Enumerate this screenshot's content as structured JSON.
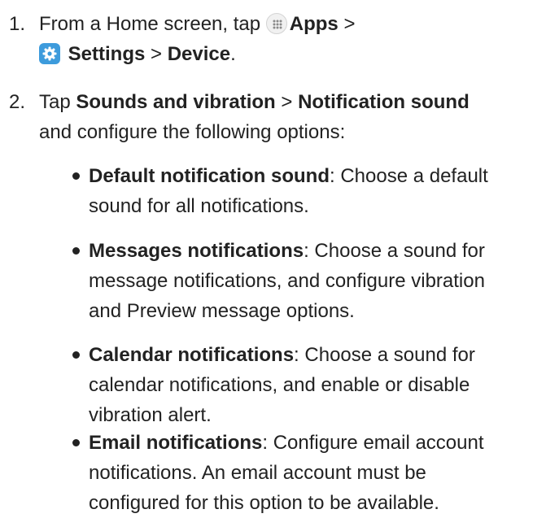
{
  "step1": {
    "number": "1.",
    "prefix": "From a Home screen, tap",
    "apps_label": "Apps",
    "sep1": ">",
    "settings_label": "Settings",
    "sep2": ">",
    "device_label": "Device",
    "end": ".",
    "icons": [
      "apps-grid-icon",
      "settings-gear-icon"
    ]
  },
  "step2": {
    "number": "2.",
    "tap": "Tap",
    "sounds_label": "Sounds and vibration",
    "sep": ">",
    "notification_label": "Notification sound",
    "line2": "and configure the following options:"
  },
  "bullets": [
    {
      "term": "Default notification sound",
      "line1_rest": ": Choose a default",
      "line2": "sound for all notifications."
    },
    {
      "term": "Messages notifications",
      "line1_rest": ": Choose a sound for",
      "line2": "message notifications, and configure vibration",
      "line3": "and Preview message options."
    },
    {
      "term": "Calendar notifications",
      "line1_rest": ": Choose a sound for",
      "line2": "calendar notifications, and enable or disable",
      "line3": "vibration alert."
    },
    {
      "term": "Email notifications",
      "line1_rest": ": Configure email account",
      "line2": "notifications. An email account must be",
      "line3": "configured for this option to be available."
    }
  ]
}
